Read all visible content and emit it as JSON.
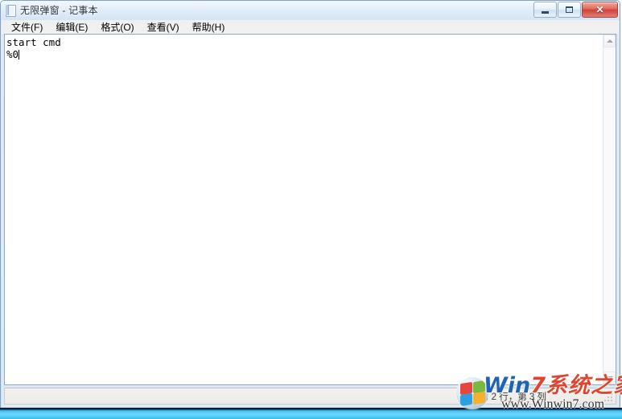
{
  "window": {
    "title": "无限弹窗 - 记事本",
    "icon": "notepad-icon"
  },
  "titlebar_buttons": {
    "minimize": "最小化",
    "maximize": "最大化",
    "close": "✕"
  },
  "menubar": {
    "items": [
      {
        "label": "文件(F)",
        "name": "menu-file"
      },
      {
        "label": "编辑(E)",
        "name": "menu-edit"
      },
      {
        "label": "格式(O)",
        "name": "menu-format"
      },
      {
        "label": "查看(V)",
        "name": "menu-view"
      },
      {
        "label": "帮助(H)",
        "name": "menu-help"
      }
    ]
  },
  "editor": {
    "content": "start cmd\n%0",
    "lines": [
      "start cmd",
      "%0"
    ],
    "caret_visible": true
  },
  "statusbar": {
    "position_text": "第 2 行，第 3 列",
    "line": 2,
    "column": 3
  },
  "scrollbar": {
    "up_arrow": "▲",
    "down_arrow": "▼"
  },
  "watermark": {
    "brand_win": "Win",
    "brand_seven": "7",
    "brand_cn": "系统之家",
    "url": "www.Winwin7.com",
    "logo": "windows-orb-logo"
  },
  "colors": {
    "frame": "#7ea2c4",
    "title_text": "#22303d",
    "close_button": "#cf4136",
    "menu_bg": "#f0f0f0",
    "client_bg": "#dfe9f4",
    "editor_bg": "#ffffff",
    "statusbar_bg": "#f1efec",
    "taskbar": "#3fc2f2",
    "watermark_blue": "#1e63b5",
    "watermark_red": "#e0462e"
  }
}
